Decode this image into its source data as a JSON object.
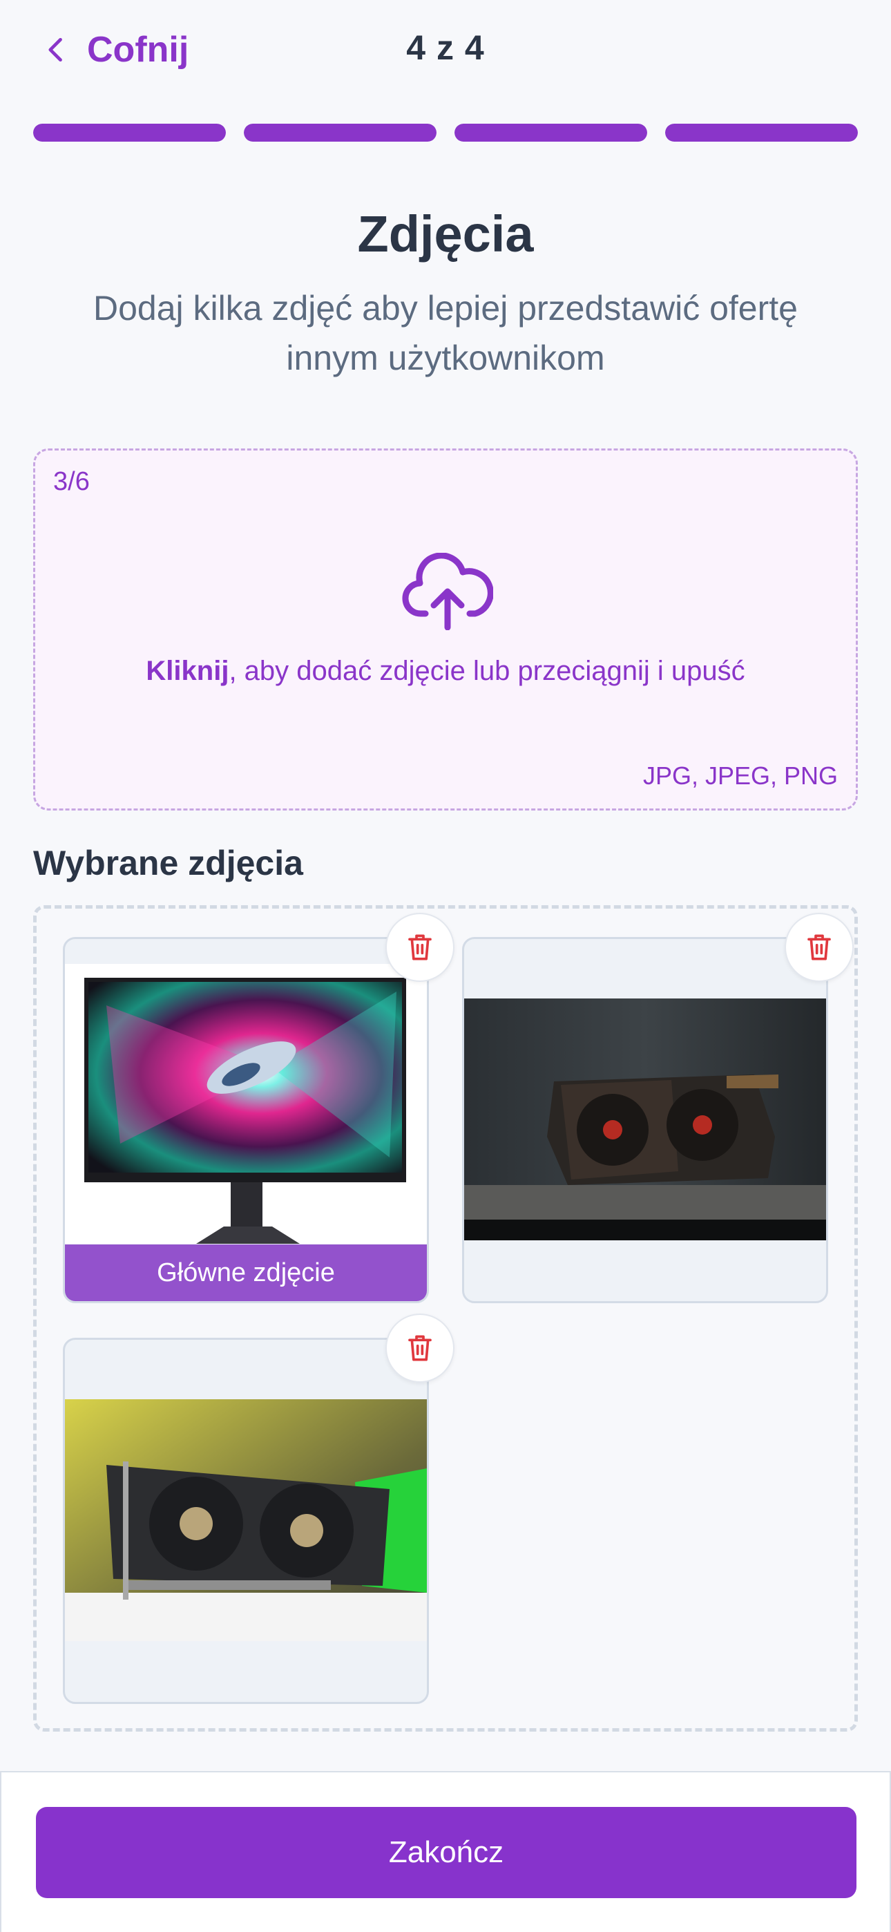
{
  "header": {
    "back_label": "Cofnij",
    "step_counter": "4 z 4"
  },
  "progress": {
    "total_steps": 4,
    "current_step": 4,
    "fills": [
      1,
      1,
      1,
      1
    ]
  },
  "page": {
    "title": "Zdjęcia",
    "subtitle": "Dodaj kilka zdjęć aby lepiej przedstawić ofertę innym użytkownikom"
  },
  "upload": {
    "count": "3/6",
    "hint_bold": "Kliknij",
    "hint_rest": ", aby dodać zdjęcie lub przeciągnij i upuść",
    "formats": "JPG, JPEG, PNG",
    "icon": "cloud-upload-icon"
  },
  "selected": {
    "title": "Wybrane zdjęcia",
    "main_label": "Główne zdjęcie",
    "photos": [
      {
        "name": "monitor",
        "is_main": true
      },
      {
        "name": "graphics-card-dark",
        "is_main": false
      },
      {
        "name": "graphics-card-green",
        "is_main": false
      }
    ]
  },
  "footer": {
    "finish_label": "Zakończ"
  },
  "colors": {
    "accent": "#8a35c9",
    "button": "#8733cc",
    "main_label_bg": "#9352cc",
    "trash": "#e0383e",
    "text_dark": "#2b3546",
    "text_muted": "#5c6b80"
  }
}
